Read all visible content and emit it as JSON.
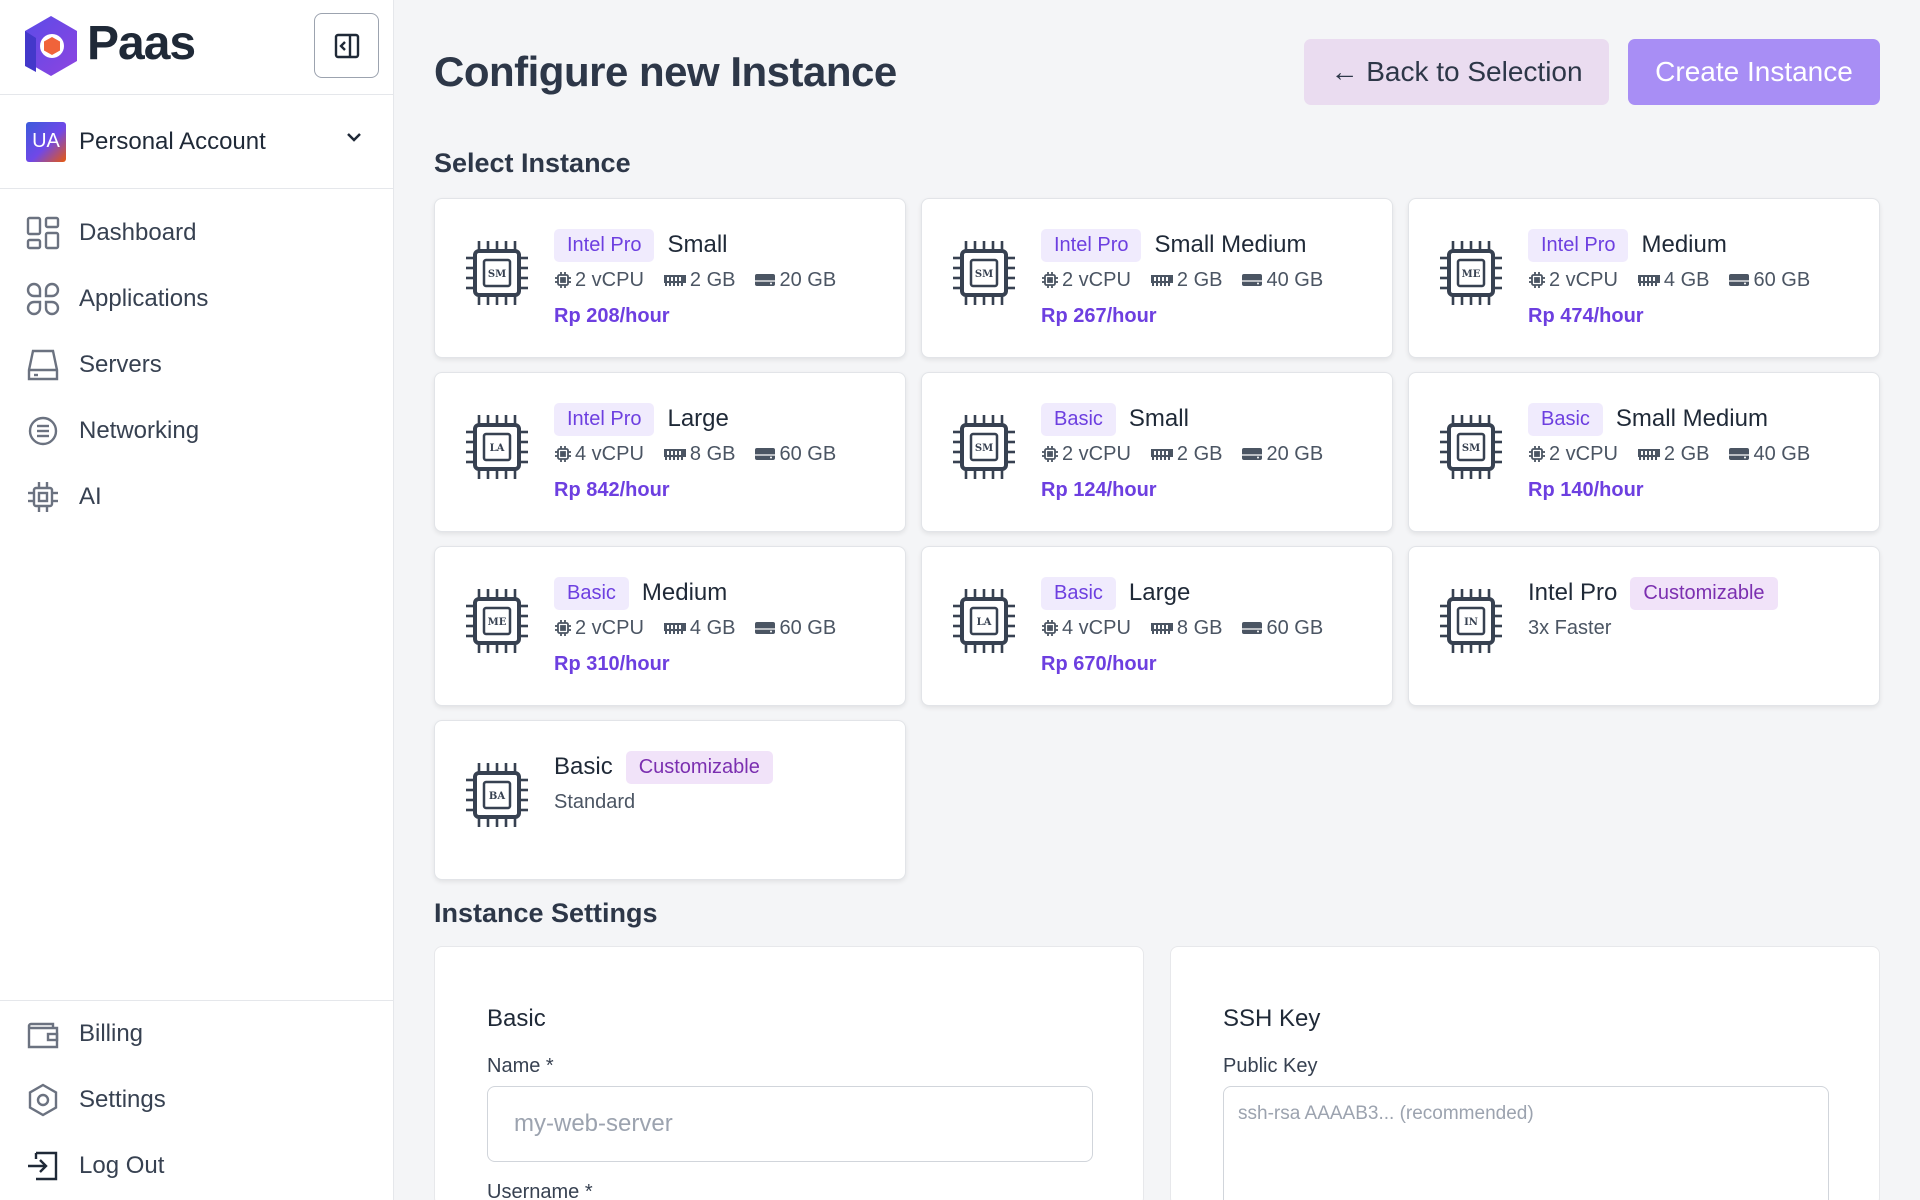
{
  "brand": {
    "name": "Paas"
  },
  "account": {
    "initials": "UA",
    "name": "Personal Account"
  },
  "nav": {
    "items": [
      {
        "label": "Dashboard",
        "icon": "dashboard-icon"
      },
      {
        "label": "Applications",
        "icon": "applications-icon"
      },
      {
        "label": "Servers",
        "icon": "servers-icon"
      },
      {
        "label": "Networking",
        "icon": "networking-icon"
      },
      {
        "label": "AI",
        "icon": "chip-icon"
      }
    ],
    "bottom": [
      {
        "label": "Billing",
        "icon": "wallet-icon"
      },
      {
        "label": "Settings",
        "icon": "settings-icon"
      },
      {
        "label": "Log Out",
        "icon": "logout-icon"
      }
    ]
  },
  "header": {
    "title": "Configure new Instance",
    "back_label": "← Back to Selection",
    "create_label": "Create Instance"
  },
  "select_section": {
    "title": "Select Instance"
  },
  "instances": [
    {
      "abbr": "SM",
      "tag": "Intel Pro",
      "name": "Small",
      "vcpu": "2 vCPU",
      "ram": "2 GB",
      "disk": "20 GB",
      "price": "Rp 208/hour"
    },
    {
      "abbr": "SM",
      "tag": "Intel Pro",
      "name": "Small Medium",
      "vcpu": "2 vCPU",
      "ram": "2 GB",
      "disk": "40 GB",
      "price": "Rp 267/hour"
    },
    {
      "abbr": "ME",
      "tag": "Intel Pro",
      "name": "Medium",
      "vcpu": "2 vCPU",
      "ram": "4 GB",
      "disk": "60 GB",
      "price": "Rp 474/hour"
    },
    {
      "abbr": "LA",
      "tag": "Intel Pro",
      "name": "Large",
      "vcpu": "4 vCPU",
      "ram": "8 GB",
      "disk": "60 GB",
      "price": "Rp 842/hour"
    },
    {
      "abbr": "SM",
      "tag": "Basic",
      "name": "Small",
      "vcpu": "2 vCPU",
      "ram": "2 GB",
      "disk": "20 GB",
      "price": "Rp 124/hour"
    },
    {
      "abbr": "SM",
      "tag": "Basic",
      "name": "Small Medium",
      "vcpu": "2 vCPU",
      "ram": "2 GB",
      "disk": "40 GB",
      "price": "Rp 140/hour"
    },
    {
      "abbr": "ME",
      "tag": "Basic",
      "name": "Medium",
      "vcpu": "2 vCPU",
      "ram": "4 GB",
      "disk": "60 GB",
      "price": "Rp 310/hour"
    },
    {
      "abbr": "LA",
      "tag": "Basic",
      "name": "Large",
      "vcpu": "4 vCPU",
      "ram": "8 GB",
      "disk": "60 GB",
      "price": "Rp 670/hour"
    }
  ],
  "custom_instances": [
    {
      "abbr": "IN",
      "name": "Intel Pro",
      "tag": "Customizable",
      "subtitle": "3x Faster"
    },
    {
      "abbr": "BA",
      "name": "Basic",
      "tag": "Customizable",
      "subtitle": "Standard"
    }
  ],
  "settings_section": {
    "title": "Instance Settings"
  },
  "basic_panel": {
    "title": "Basic",
    "name_label": "Name *",
    "name_placeholder": "my-web-server",
    "username_label": "Username *"
  },
  "ssh_panel": {
    "title": "SSH Key",
    "key_label": "Public Key",
    "key_placeholder": "ssh-rsa AAAAB3... (recommended)"
  },
  "colors": {
    "accent": "#6d3fe0",
    "create_button": "#a88ef5",
    "back_button": "#eadcf0",
    "tag_bg": "#f0ebfd"
  }
}
